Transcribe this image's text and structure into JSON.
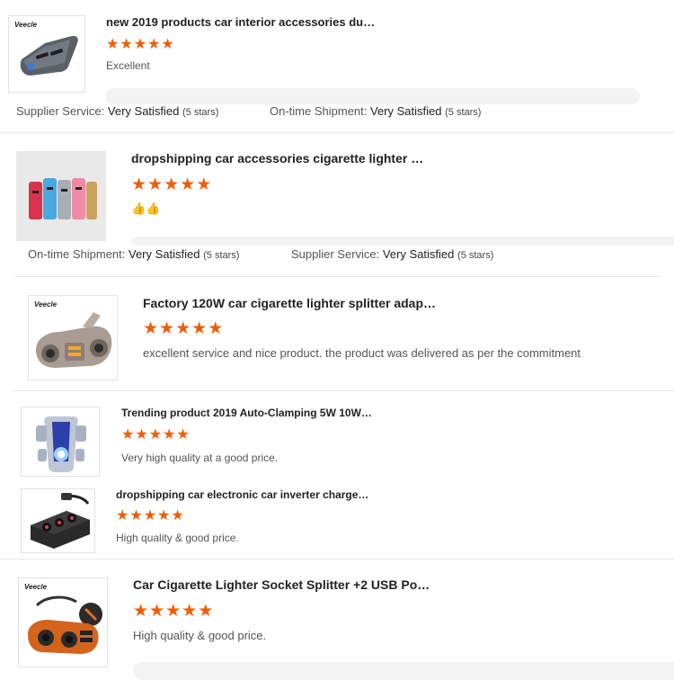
{
  "reviews": [
    {
      "title": "new 2019 products car interior accessories du…",
      "rating": 5,
      "comment": "Excellent",
      "thumb_icon": "car-charger-icon",
      "brand": "Veecle",
      "service": [
        {
          "label": "Supplier Service:",
          "value": "Very Satisfied",
          "stars": "(5 stars)"
        },
        {
          "label": "On-time Shipment:",
          "value": "Very Satisfied",
          "stars": "(5 stars)"
        }
      ]
    },
    {
      "title": "dropshipping car accessories cigarette lighter …",
      "rating": 5,
      "comment": "👍👍",
      "thumb_icon": "colorful-chargers-icon",
      "service": [
        {
          "label": "On-time Shipment:",
          "value": "Very Satisfied",
          "stars": "(5 stars)"
        },
        {
          "label": "Supplier Service:",
          "value": "Very Satisfied",
          "stars": "(5 stars)"
        }
      ]
    },
    {
      "title": "Factory 120W car cigarette lighter splitter adap…",
      "rating": 5,
      "comment": "excellent service and nice product. the product was delivered as per the commitment",
      "thumb_icon": "lighter-splitter-icon",
      "brand": "Veecle"
    },
    {
      "title": "Trending product 2019 Auto-Clamping 5W 10W…",
      "rating": 5,
      "comment": "Very high quality at a good price.",
      "thumb_icon": "phone-holder-icon"
    },
    {
      "title": "dropshipping car electronic car inverter charge…",
      "rating": 5,
      "comment": "High quality & good price.",
      "thumb_icon": "inverter-socket-icon"
    },
    {
      "title": "Car Cigarette Lighter Socket Splitter +2 USB Po…",
      "rating": 5,
      "comment": "High quality & good price.",
      "thumb_icon": "socket-splitter-icon",
      "brand": "Veecle"
    }
  ],
  "colors": {
    "star": "#f25c05",
    "divider": "#e8e8e8"
  }
}
